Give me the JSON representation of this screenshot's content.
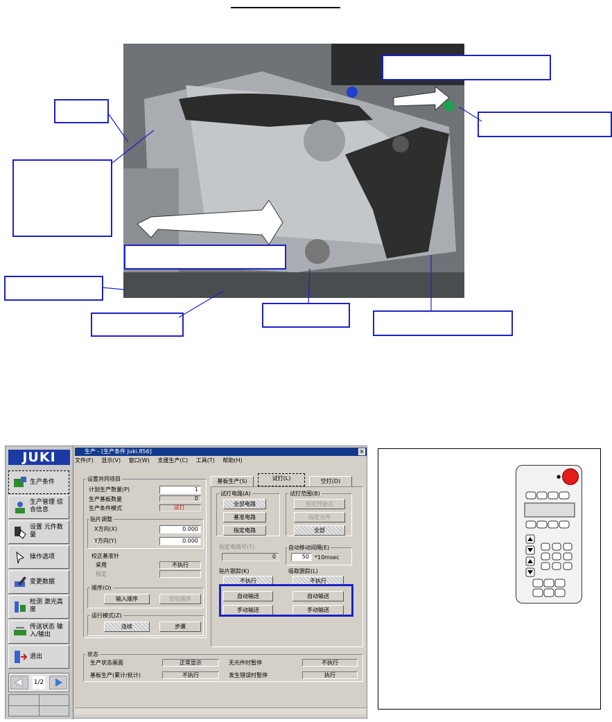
{
  "app": {
    "logo": "JUKI",
    "sidebar": [
      {
        "label": "生产条件",
        "icon": "production-condition-icon"
      },
      {
        "label": "生产管理 综合信息",
        "icon": "production-management-icon"
      },
      {
        "label": "设置 元件数量",
        "icon": "component-count-icon"
      },
      {
        "label": "操作选项",
        "icon": "operation-options-icon"
      },
      {
        "label": "变更数据",
        "icon": "change-data-icon"
      },
      {
        "label": "检测 激光高度",
        "icon": "laser-height-icon"
      },
      {
        "label": "传送状态 输入/输出",
        "icon": "transfer-status-icon"
      },
      {
        "label": "退出",
        "icon": "exit-icon"
      }
    ],
    "page_indicator": "1/2",
    "window_title": "生产 - [生产条件 Juki.856]",
    "menu": [
      "文件(F)",
      "显示(V)",
      "窗口(W)",
      "支援生产(C)",
      "工具(T)",
      "帮助(H)"
    ],
    "common": {
      "title": "设置共同项目",
      "planned_label": "计划生产数量(P)",
      "planned_value": "1",
      "produced_label": "生产基板数量",
      "produced_value": "0",
      "mode_label": "生产条件模式",
      "mode_value": "试打"
    },
    "placement": {
      "title": "贴片调整",
      "x_label": "X方向(X)",
      "x_value": "0.000",
      "y_label": "Y方向(Y)",
      "y_value": "0.000"
    },
    "mark": {
      "title": "校正基准针",
      "use_label": "采用",
      "use_value": "不执行",
      "point_label": "指定"
    },
    "order": {
      "title": "顺序(O)",
      "btn1": "输入顺序",
      "btn2": "优化顺序"
    },
    "runmode": {
      "title": "运行模式(Z)",
      "btn1": "连续",
      "btn2": "步骤"
    },
    "tabs": [
      "基板生产(S)",
      "试打(L)",
      "空打(D)"
    ],
    "trial_circuit": {
      "title": "试打电路(A)",
      "buttons": [
        "全部电路",
        "基准电路",
        "指定电路"
      ]
    },
    "trial_range": {
      "title": "试打范围(B)",
      "buttons": [
        "指定开始点",
        "指定元件",
        "全部"
      ]
    },
    "designated_circuit_label": "指定电路号(T)",
    "designated_circuit_value": "0",
    "auto_interval": {
      "title": "自动移动间隔(E)",
      "value": "50",
      "unit": "*10msec"
    },
    "place_trace": {
      "title": "贴片跟踪(K)",
      "buttons": [
        "不执行",
        "自动输送",
        "手动输送"
      ]
    },
    "pick_trace": {
      "title": "吸取跟踪(L)",
      "buttons": [
        "不执行",
        "自动输送",
        "手动输送"
      ]
    },
    "status": {
      "title": "状态",
      "rows": [
        {
          "label": "生产状态画面",
          "value": "正常显示",
          "label2": "无元件时暂停",
          "value2": "不执行"
        },
        {
          "label": "基板生产(累计/批计)",
          "value": "不执行",
          "label2": "发生错误时暂停",
          "value2": "执行"
        }
      ]
    }
  },
  "colors": {
    "highlight": "#1c20c8",
    "titlebar": "#123a8c",
    "stop_button": "#e41b17"
  }
}
